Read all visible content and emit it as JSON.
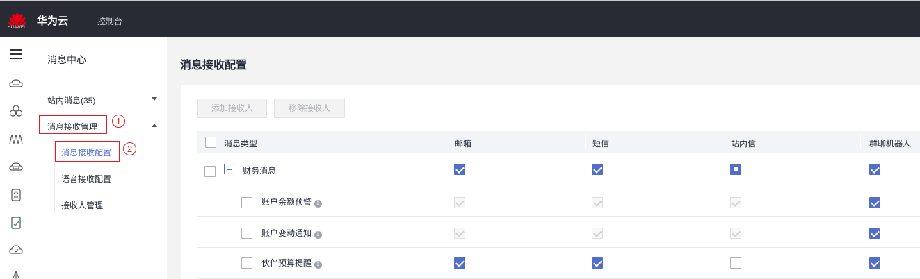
{
  "topbar": {
    "logo_text": "HUAWEI",
    "brand": "华为云",
    "console_link": "控制台"
  },
  "rail_icons": [
    "menu-icon",
    "cloud-server-icon",
    "cluster-icon",
    "network-icon",
    "storage-icon",
    "database-icon",
    "security-icon",
    "cloud-icon",
    "more-icon"
  ],
  "sidebar": {
    "title": "消息中心",
    "items": [
      {
        "label": "站内消息(35)",
        "expanded": false
      },
      {
        "label": "消息接收管理",
        "expanded": true
      }
    ],
    "subitems": [
      {
        "label": "消息接收配置",
        "active": true
      },
      {
        "label": "语音接收配置",
        "active": false
      },
      {
        "label": "接收人管理",
        "active": false
      }
    ],
    "annotations": [
      "1",
      "2"
    ]
  },
  "main": {
    "page_title": "消息接收配置",
    "buttons": {
      "add_receiver": "添加接收人",
      "remove_receiver": "移除接收人"
    },
    "table": {
      "columns": [
        "消息类型",
        "邮箱",
        "短信",
        "站内信",
        "群聊机器人"
      ],
      "rows": [
        {
          "name": "财务消息",
          "group": true,
          "checks": [
            "checked",
            "checked",
            "partial",
            "checked"
          ]
        },
        {
          "name": "账户余额预警",
          "group": false,
          "info": true,
          "checks": [
            "disabled",
            "disabled",
            "disabled",
            "checked"
          ]
        },
        {
          "name": "账户变动通知",
          "group": false,
          "info": true,
          "checks": [
            "disabled",
            "disabled",
            "disabled",
            "checked"
          ]
        },
        {
          "name": "伙伴预算提醒",
          "group": false,
          "info": true,
          "checks": [
            "checked",
            "checked",
            "unchecked",
            "checked"
          ]
        }
      ]
    }
  },
  "colors": {
    "topbar_bg": "#282b33",
    "accent": "#526ecc",
    "annotation_red": "#e11d1d"
  }
}
